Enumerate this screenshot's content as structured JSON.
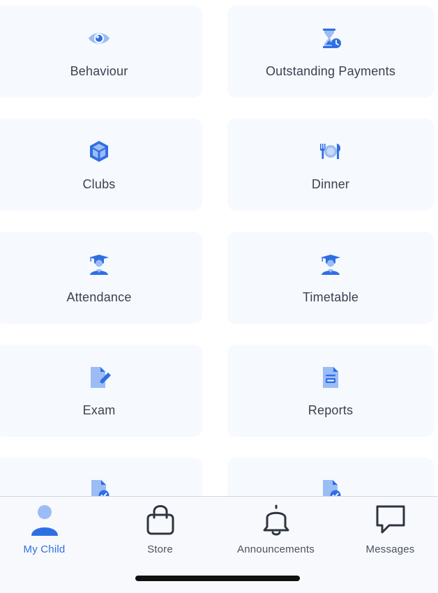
{
  "colors": {
    "accent": "#2f6fe4",
    "icon_light": "#8fb4f5",
    "tile_bg": "#f6f9fd",
    "text": "#3a4150"
  },
  "tiles": [
    {
      "label": "Behaviour",
      "icon": "eye-icon"
    },
    {
      "label": "Outstanding Payments",
      "icon": "hourglass-clock-icon"
    },
    {
      "label": "Clubs",
      "icon": "cube-icon"
    },
    {
      "label": "Dinner",
      "icon": "cutlery-plate-icon"
    },
    {
      "label": "Attendance",
      "icon": "graduate-icon"
    },
    {
      "label": "Timetable",
      "icon": "graduate-icon"
    },
    {
      "label": "Exam",
      "icon": "document-pen-icon"
    },
    {
      "label": "Reports",
      "icon": "report-document-icon"
    },
    {
      "label": "",
      "icon": "document-check-icon"
    },
    {
      "label": "",
      "icon": "document-check-icon"
    }
  ],
  "tabbar": {
    "active": "my_child",
    "tabs": [
      {
        "id": "my_child",
        "label": "My Child",
        "icon": "person-icon"
      },
      {
        "id": "store",
        "label": "Store",
        "icon": "shopping-bag-icon"
      },
      {
        "id": "announcements",
        "label": "Announcements",
        "icon": "bell-icon"
      },
      {
        "id": "messages",
        "label": "Messages",
        "icon": "chat-bubble-icon"
      }
    ]
  }
}
